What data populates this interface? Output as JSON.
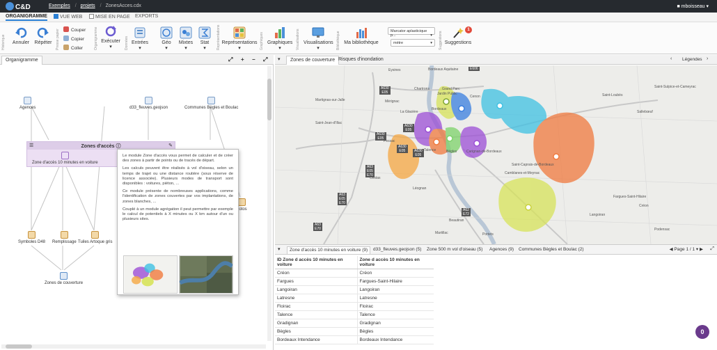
{
  "topbar": {
    "logo": "C&D",
    "breadcrumb": [
      "Exemples",
      "projets",
      "ZonesAcces.cdx"
    ],
    "user": "mboisseau"
  },
  "menubar": {
    "tabs": [
      "ORGANIGRAMME",
      "VUE WEB",
      "MISE EN PAGE",
      "EXPORTS"
    ],
    "vue_web_checked": true,
    "mise_en_page_checked": false
  },
  "ribbon": {
    "section_labels": [
      "Historique",
      "Presse papier",
      "Organigramme",
      "Données",
      "Représentations",
      "Graphiques",
      "Visualisations",
      "Bibliothèque",
      "Suggestions"
    ],
    "undo": "Annuler",
    "redo": "Répéter",
    "cut": "Couper",
    "copy": "Copier",
    "paste": "Coller",
    "execute": "Exécuter",
    "inputs": "Entrées",
    "geo": "Géo",
    "mixed": "Mixtes",
    "stat": "Stat",
    "representations": "Représentations",
    "charts": "Graphiques",
    "visualisations": "Visualisations",
    "library": "Ma bibliothèque",
    "marker_select": "Marcator aplasticique p...",
    "unit_select": "mètre",
    "suggestions": "Suggestions",
    "suggestions_count": "1"
  },
  "left_panel": {
    "tab": "Organigramme",
    "nodes": {
      "agences": "Agences",
      "d33": "d33_fleuves.geojson",
      "communes": "Communes Bègles et Boulac",
      "zone10": "Zone d'accès 10 minutes en voiture",
      "symboles": "Symboles D48",
      "remplissage": "Remplissage",
      "tuiles": "Tuiles Artoque gris",
      "zones_couverture": "Zones de couverture",
      "photos": "hotos"
    },
    "group_title": "Zones d'accès",
    "tooltip": {
      "p1": "Le module Zone d'accès vous permet de calculer et de créer des zones à partir de points ou de tracés de départ.",
      "p2": "Les calculs peuvent être réalisés à vol d'oiseau, selon un temps de trajet ou une distance routière (sous réserve de licence associée). Plusieurs modes de transport sont disponibles : voitures, piéton, ...",
      "p3": "Ce module présente de nombreuses applications, comme l'identification de zones couvertes par vos implantations, de zones blanches, ...",
      "p4": "Couplé à un module agrégation il peut permettre par exemple le calcul de potentiels à X minutes ou X km autour d'un ou plusieurs sites."
    }
  },
  "right_panel": {
    "tabs": [
      "Zones de couverture",
      "Risques d'inondation"
    ],
    "legend_label": "Légendes",
    "map_labels": [
      "Eysines",
      "Bordeaux Aquitaine",
      "Chartrons",
      "Grand Parc",
      "Jardin Public",
      "Cenon",
      "Mérignac",
      "La Glacière",
      "Bordeaux",
      "Martignas-sur-Jalle",
      "Saint-Jean-d'Illac",
      "Pessac",
      "Talence",
      "Bègles",
      "Cestas",
      "Léognan",
      "Carignan-de-Bordeaux",
      "Sallebœuf",
      "Saint-Loubès",
      "Camblanes-et-Meynac",
      "Martillac",
      "Saint-Caprais-de-Bordeaux",
      "Beautiran",
      "Podensac",
      "Portets",
      "Saint-Sulpice-et-Cameyrac",
      "Fargues-Saint-Hilaire",
      "Créon",
      "Langoiran"
    ],
    "road_labels": [
      "A630|E05",
      "A630|E05",
      "A630|E05",
      "A63|E05|E70",
      "A62|E72",
      "A63|E05|E70",
      "A63|E70",
      "E606",
      "A630|E05",
      "A630|E05"
    ],
    "bottom_tabs": [
      "Zone d'accès 10 minutes en voiture (9)",
      "d33_fleuves.geojson (5)",
      "Zone 500 m vol d'oiseau (5)",
      "Agences (9)",
      "Communes Bègles et Boulac (2)"
    ],
    "pager": "Page 1 / 1",
    "table": {
      "headers": [
        "ID Zone d accès 10 minutes en voiture",
        "Zone d accès 10 minutes en voiture"
      ],
      "rows": [
        [
          "Créon",
          "Créon"
        ],
        [
          "Fargues",
          "Fargues-Saint-Hilaire"
        ],
        [
          "Langoiran",
          "Langoiran"
        ],
        [
          "Latresne",
          "Latresne"
        ],
        [
          "Floirac",
          "Floirac"
        ],
        [
          "Talence",
          "Talence"
        ],
        [
          "Gradignan",
          "Gradignan"
        ],
        [
          "Bègles",
          "Bègles"
        ],
        [
          "Bordeaux Intendance",
          "Bordeaux Intendance"
        ]
      ]
    }
  },
  "fab_label": "0",
  "colors": {
    "topbar": "#262a2f",
    "accent": "#2a7fd4",
    "zone_purple": "#9c4fd6",
    "zone_cyan": "#3fc1e3",
    "zone_orange": "#f07a3f",
    "zone_yellow": "#d7e35a",
    "zone_blue": "#3a7fe0",
    "zone_green": "#7ed36a"
  }
}
